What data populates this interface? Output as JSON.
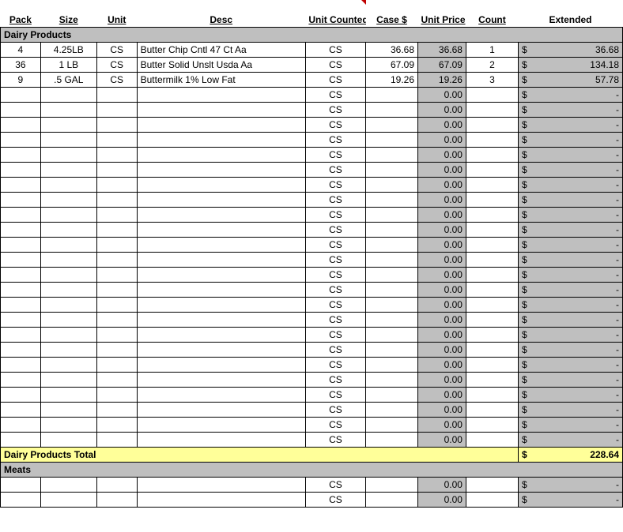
{
  "headers": {
    "pack": "Pack",
    "size": "Size",
    "unit": "Unit",
    "desc": "Desc",
    "unit_counted": "Unit Counted",
    "case": "Case $",
    "unit_price": "Unit Price",
    "count": "Count",
    "extended": "Extended"
  },
  "sections": {
    "dairy": {
      "label": "Dairy Products",
      "total_label": "Dairy Products Total",
      "total_value": "228.64"
    },
    "meats": {
      "label": "Meats"
    }
  },
  "currency": "$",
  "dash": "-",
  "default_uc": "CS",
  "default_price": "0.00",
  "dairy_rows": [
    {
      "pack": "4",
      "size": "4.25LB",
      "unit": "CS",
      "desc": "Butter Chip Cntl 47 Ct Aa",
      "uc": "CS",
      "case": "36.68",
      "price": "36.68",
      "count": "1",
      "ext": "36.68"
    },
    {
      "pack": "36",
      "size": "1 LB",
      "unit": "CS",
      "desc": "Butter Solid Unslt Usda Aa",
      "uc": "CS",
      "case": "67.09",
      "price": "67.09",
      "count": "2",
      "ext": "134.18"
    },
    {
      "pack": "9",
      "size": ".5 GAL",
      "unit": "CS",
      "desc": "Buttermilk 1% Low Fat",
      "uc": "CS",
      "case": "19.26",
      "price": "19.26",
      "count": "3",
      "ext": "57.78"
    }
  ],
  "dairy_empty_count": 24,
  "meats_empty_count": 2
}
